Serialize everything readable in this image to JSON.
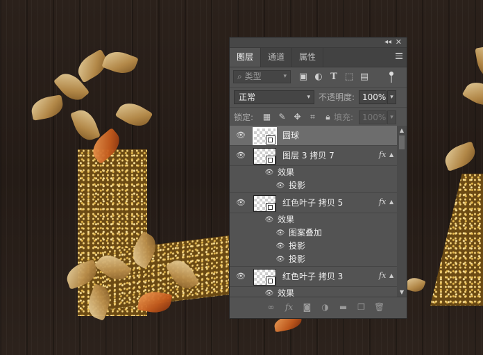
{
  "panel": {
    "tabs": [
      {
        "label": "图层",
        "active": true
      },
      {
        "label": "通道",
        "active": false
      },
      {
        "label": "属性",
        "active": false
      }
    ],
    "filter_placeholder": "类型",
    "blend_mode": "正常",
    "opacity_label": "不透明度:",
    "opacity_value": "100%",
    "lock_label": "锁定:",
    "fill_label": "填充:",
    "fill_value": "100%",
    "layers": [
      {
        "name": "圆球",
        "selected": true,
        "fx": false,
        "effects_label": "",
        "effects": []
      },
      {
        "name": "图层 3 拷贝 7",
        "selected": false,
        "fx": true,
        "effects_label": "效果",
        "effects": [
          "投影"
        ]
      },
      {
        "name": "红色叶子 拷贝 5",
        "selected": false,
        "fx": true,
        "effects_label": "效果",
        "effects": [
          "图案叠加",
          "投影",
          "投影"
        ]
      },
      {
        "name": "红色叶子 拷贝 3",
        "selected": false,
        "fx": true,
        "effects_label": "效果",
        "effects": []
      }
    ],
    "fx_label": "fx"
  },
  "icons": {
    "filter": [
      "image-filter-icon",
      "adjustment-filter-icon",
      "text-filter-icon",
      "shape-filter-icon",
      "smart-object-filter-icon"
    ],
    "lock": [
      "lock-transparent-icon",
      "lock-paint-icon",
      "lock-position-icon",
      "lock-artboard-icon",
      "lock-all-icon"
    ],
    "bottom": [
      "link-layers-icon",
      "fx-icon",
      "add-mask-icon",
      "adjustment-layer-icon",
      "new-group-icon",
      "new-layer-icon",
      "delete-layer-icon"
    ]
  },
  "colors": {
    "panel_bg": "#535353",
    "selected_row": "#6d6d6d",
    "tab_bar": "#424242"
  }
}
